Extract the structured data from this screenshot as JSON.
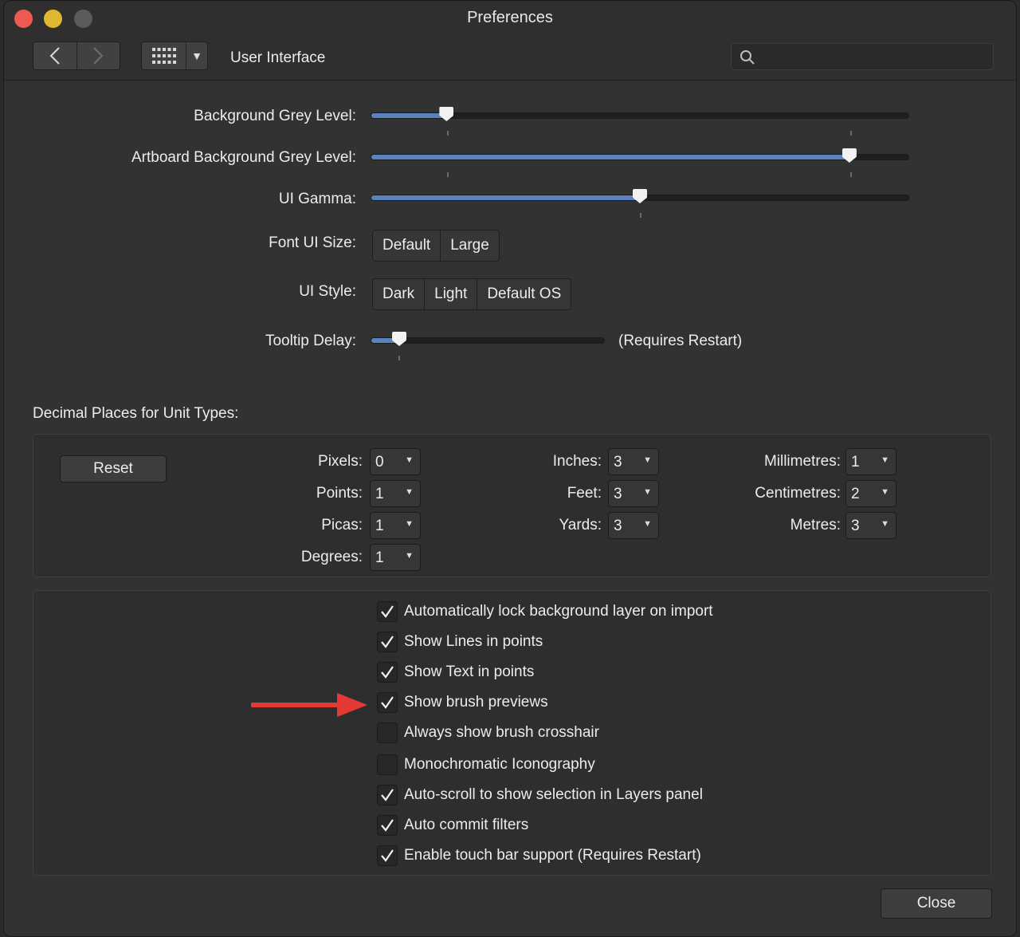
{
  "window": {
    "title": "Preferences"
  },
  "toolbar": {
    "section_label": "User Interface",
    "back_icon": "chevron-left-icon",
    "forward_icon": "chevron-right-icon",
    "grid_icon": "grid-icon",
    "search_placeholder": ""
  },
  "sliders": {
    "background_grey": {
      "label": "Background Grey Level:",
      "value_fraction": 0.14
    },
    "artboard_grey": {
      "label": "Artboard Background Grey Level:",
      "value_fraction": 0.89
    },
    "ui_gamma": {
      "label": "UI Gamma:",
      "value_fraction": 0.5
    },
    "tooltip_delay": {
      "label": "Tooltip Delay:",
      "value_fraction": 0.12,
      "note": "(Requires Restart)"
    }
  },
  "font_ui_size": {
    "label": "Font UI Size:",
    "options": [
      "Default",
      "Large"
    ]
  },
  "ui_style": {
    "label": "UI Style:",
    "options": [
      "Dark",
      "Light",
      "Default OS"
    ]
  },
  "decimal_places": {
    "title": "Decimal Places for Unit Types:",
    "reset_label": "Reset",
    "units": {
      "pixels": {
        "label": "Pixels:",
        "value": "0"
      },
      "points": {
        "label": "Points:",
        "value": "1"
      },
      "picas": {
        "label": "Picas:",
        "value": "1"
      },
      "degrees": {
        "label": "Degrees:",
        "value": "1"
      },
      "inches": {
        "label": "Inches:",
        "value": "3"
      },
      "feet": {
        "label": "Feet:",
        "value": "3"
      },
      "yards": {
        "label": "Yards:",
        "value": "3"
      },
      "millimetres": {
        "label": "Millimetres:",
        "value": "1"
      },
      "centimetres": {
        "label": "Centimetres:",
        "value": "2"
      },
      "metres": {
        "label": "Metres:",
        "value": "3"
      }
    }
  },
  "checkboxes": [
    {
      "label": "Automatically lock background layer on import",
      "checked": true
    },
    {
      "label": "Show Lines in points",
      "checked": true
    },
    {
      "label": "Show Text in points",
      "checked": true
    },
    {
      "label": "Show brush previews",
      "checked": true
    },
    {
      "label": "Always show brush crosshair",
      "checked": false
    },
    {
      "label": "Monochromatic Iconography",
      "checked": false
    },
    {
      "label": "Auto-scroll to show selection in Layers panel",
      "checked": true
    },
    {
      "label": "Auto commit filters",
      "checked": true
    },
    {
      "label": "Enable touch bar support (Requires Restart)",
      "checked": true
    }
  ],
  "close_label": "Close",
  "colors": {
    "accent": "#5b82bd",
    "annotation_arrow": "#e53935"
  }
}
